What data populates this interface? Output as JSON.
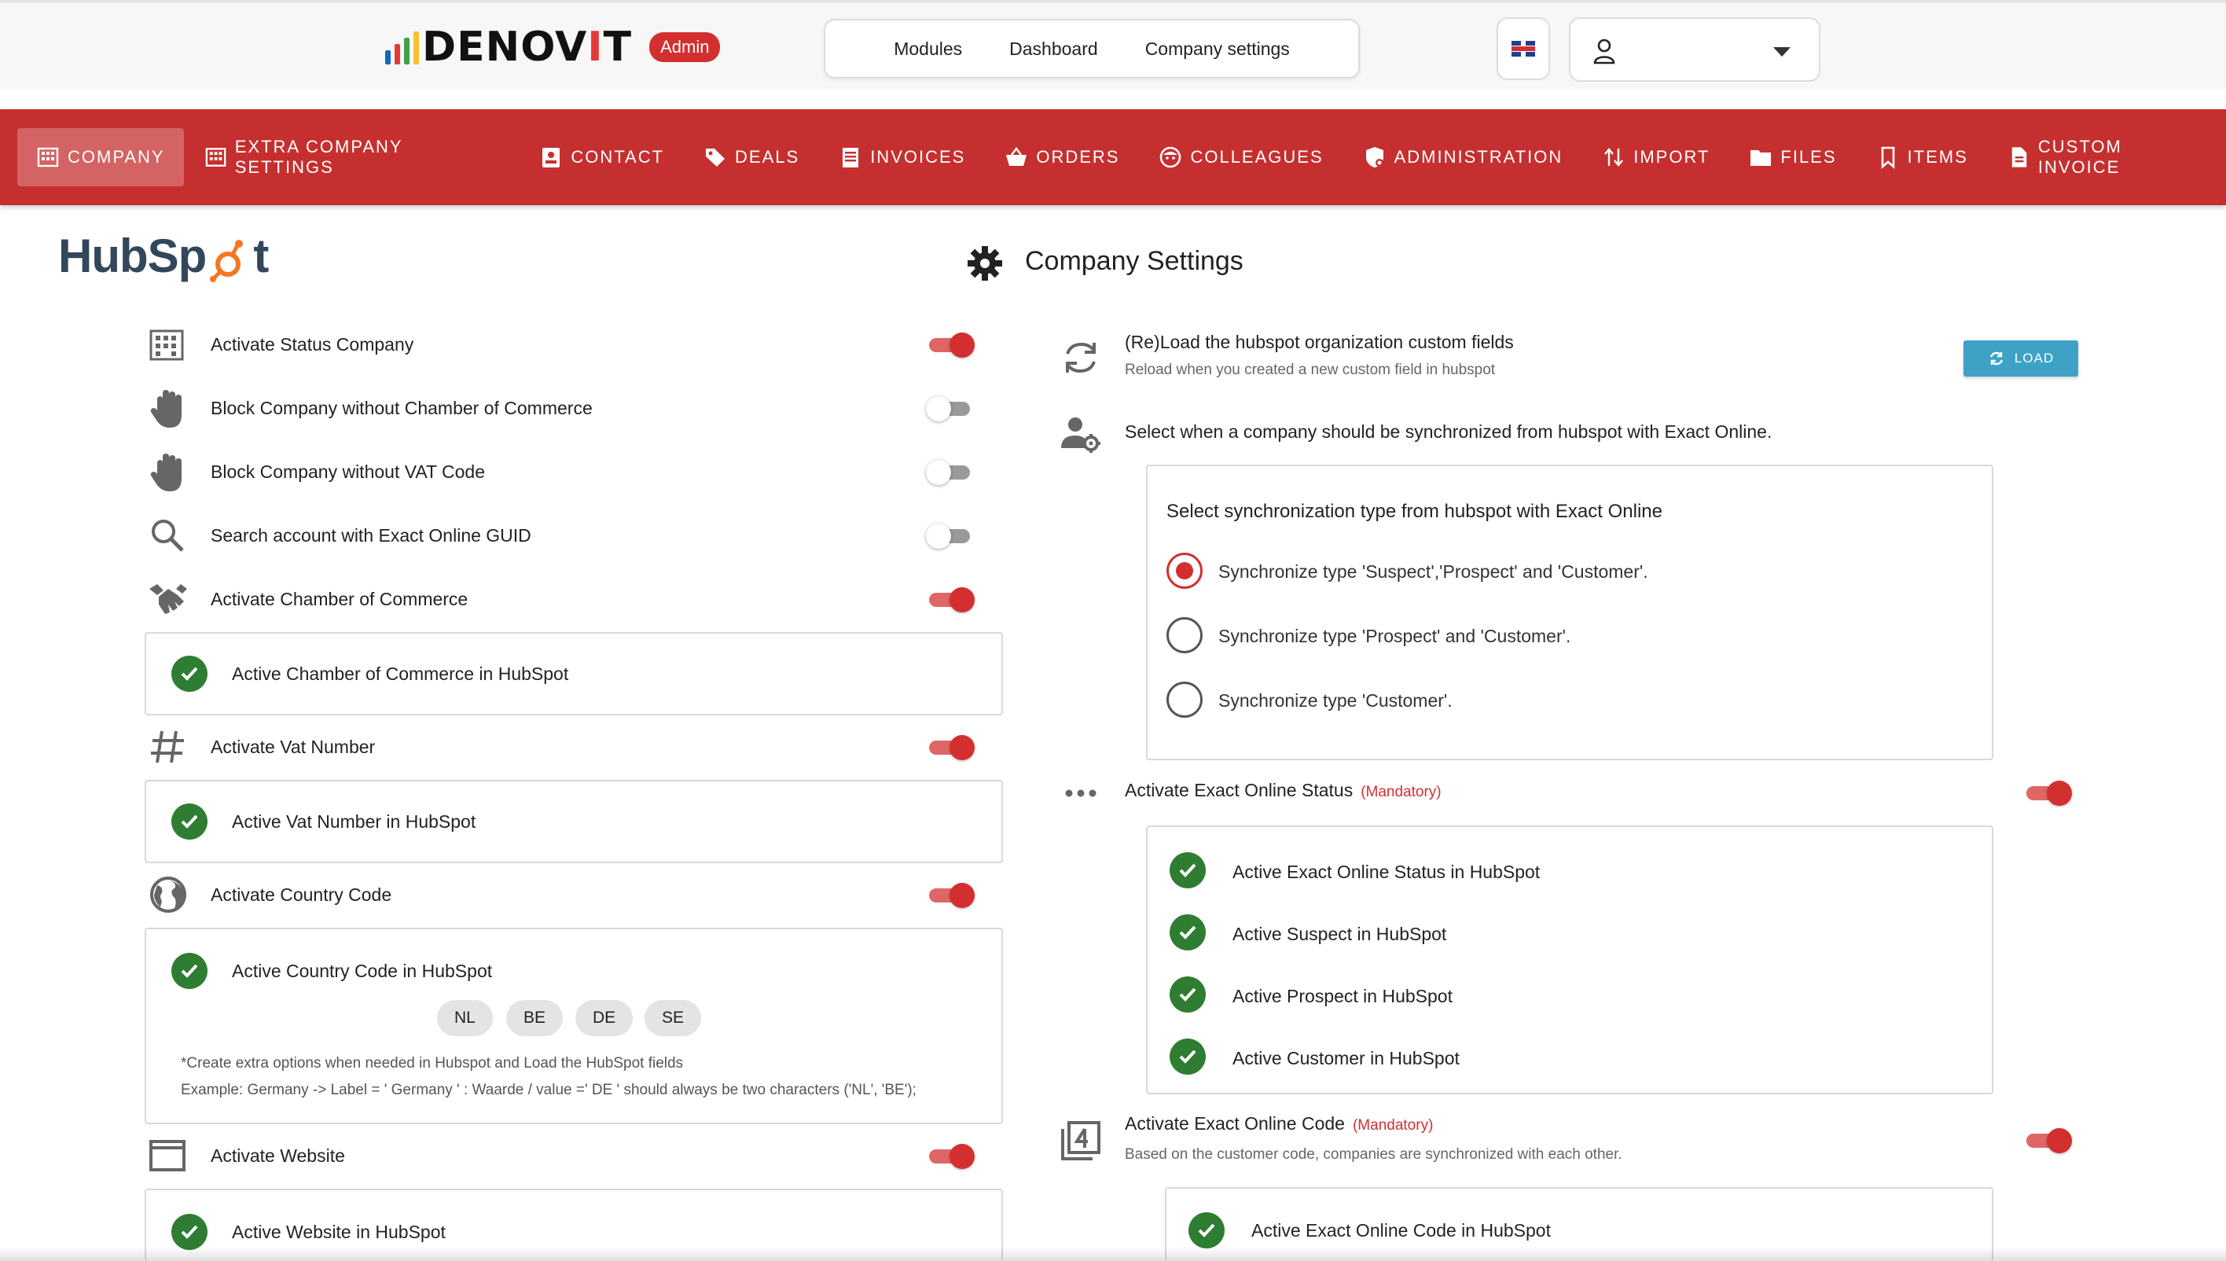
{
  "header": {
    "brand_prefix": "DENOV",
    "brand_accent": "I",
    "brand_suffix": "T",
    "badge": "Admin",
    "nav": [
      "Modules",
      "Dashboard",
      "Company settings"
    ],
    "language_icon": "uk-flag-icon",
    "user_value": ""
  },
  "menu": [
    {
      "label": "Company",
      "icon": "building-icon",
      "active": true
    },
    {
      "label": "Extra Company Settings",
      "icon": "building-icon"
    },
    {
      "label": "Contact",
      "icon": "contact-card-icon"
    },
    {
      "label": "Deals",
      "icon": "tag-icon"
    },
    {
      "label": "Invoices",
      "icon": "list-icon"
    },
    {
      "label": "Orders",
      "icon": "basket-icon"
    },
    {
      "label": "Colleagues",
      "icon": "face-icon"
    },
    {
      "label": "Administration",
      "icon": "shield-icon"
    },
    {
      "label": "Import",
      "icon": "import-icon"
    },
    {
      "label": "Files",
      "icon": "folder-icon"
    },
    {
      "label": "Items",
      "icon": "bookmark-icon"
    },
    {
      "label": "Custom Invoice",
      "icon": "document-icon"
    }
  ],
  "left": {
    "logo_text_a": "HubSp",
    "logo_text_b": "t",
    "settings": [
      {
        "label": "Activate Status Company",
        "icon": "building-icon",
        "on": true
      },
      {
        "label": "Block Company without Chamber of Commerce",
        "icon": "hand-icon",
        "on": false
      },
      {
        "label": "Block Company without VAT Code",
        "icon": "hand-icon",
        "on": false
      },
      {
        "label": "Search account with Exact Online GUID",
        "icon": "search-icon",
        "on": false
      },
      {
        "label": "Activate Chamber of Commerce",
        "icon": "handshake-icon",
        "on": true
      },
      {
        "label": "Activate Vat Number",
        "icon": "hash-icon",
        "on": true
      },
      {
        "label": "Activate Country Code",
        "icon": "globe-icon",
        "on": true
      },
      {
        "label": "Activate Website",
        "icon": "window-icon",
        "on": true
      }
    ],
    "cards": {
      "coc": "Active Chamber of Commerce in HubSpot",
      "vat": "Active Vat Number in HubSpot",
      "country": "Active Country Code in HubSpot",
      "website": "Active Website in HubSpot"
    },
    "country_chips": [
      "NL",
      "BE",
      "DE",
      "SE"
    ],
    "country_note_1": "*Create extra options when needed in Hubspot and Load the HubSpot fields",
    "country_note_2": "Example: Germany -> Label = ' Germany ' : Waarde / value =' DE ' should always be two characters ('NL', 'BE');"
  },
  "right": {
    "title": "Company Settings",
    "reload_title": "(Re)Load the hubspot organization custom fields",
    "reload_sub": "Reload when you created a new custom field in hubspot",
    "load_label": "LOAD",
    "sync_title": "Select when a company should be synchronized from hubspot with Exact Online.",
    "sync_card_title": "Select synchronization type from hubspot with Exact Online",
    "sync_options": [
      {
        "label": "Synchronize type 'Suspect','Prospect' and 'Customer'.",
        "selected": true
      },
      {
        "label": "Synchronize type 'Prospect' and 'Customer'.",
        "selected": false
      },
      {
        "label": "Synchronize type 'Customer'.",
        "selected": false
      }
    ],
    "status_title": "Activate Exact Online Status",
    "mandatory": "(Mandatory)",
    "status_items": [
      "Active Exact Online Status in HubSpot",
      "Active Suspect in HubSpot",
      "Active Prospect in HubSpot",
      "Active Customer in HubSpot"
    ],
    "code_title": "Activate Exact Online Code",
    "code_sub": "Based on the customer code, companies are synchronized with each other.",
    "code_item": "Active Exact Online Code in HubSpot"
  },
  "colors": {
    "brand_red": "#c62f2f",
    "toggle_on": "#d32f2f",
    "check_green": "#2e7d32",
    "load_button": "#3ea2c7"
  }
}
